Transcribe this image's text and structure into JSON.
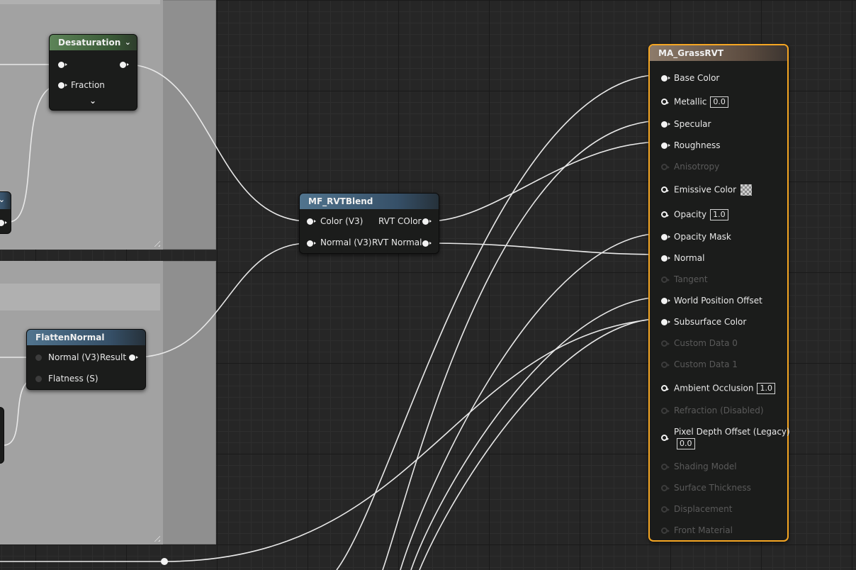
{
  "nodes": {
    "desaturation": {
      "title": "Desaturation",
      "chevron_glyph": "⌄",
      "inputs": [
        {
          "label": ""
        },
        {
          "label": "Fraction"
        }
      ],
      "expand_glyph": "⌄"
    },
    "flatten_normal": {
      "title": "FlattenNormal",
      "inputs": [
        {
          "label": "Normal (V3)"
        },
        {
          "label": "Flatness (S)"
        }
      ],
      "outputs": [
        {
          "label": "Result"
        }
      ]
    },
    "mf_rvtblend": {
      "title": "MF_RVTBlend",
      "inputs": [
        {
          "label": "Color (V3)"
        },
        {
          "label": "Normal (V3)"
        }
      ],
      "outputs": [
        {
          "label": "RVT COlor"
        },
        {
          "label": "RVT Normal"
        }
      ]
    },
    "partial_top": {
      "chevron_glyph": "⌄"
    }
  },
  "material": {
    "title": "MA_GrassRVT",
    "pins": [
      {
        "label": "Base Color",
        "state": "connected"
      },
      {
        "label": "Metallic",
        "state": "open",
        "value": "0.0"
      },
      {
        "label": "Specular",
        "state": "connected"
      },
      {
        "label": "Roughness",
        "state": "connected"
      },
      {
        "label": "Anisotropy",
        "state": "disabled"
      },
      {
        "label": "Emissive Color",
        "state": "open",
        "swatch": true
      },
      {
        "label": "Opacity",
        "state": "open",
        "value": "1.0"
      },
      {
        "label": "Opacity Mask",
        "state": "connected"
      },
      {
        "label": "Normal",
        "state": "connected"
      },
      {
        "label": "Tangent",
        "state": "disabled"
      },
      {
        "label": "World Position Offset",
        "state": "connected"
      },
      {
        "label": "Subsurface Color",
        "state": "connected"
      },
      {
        "label": "Custom Data 0",
        "state": "disabled"
      },
      {
        "label": "Custom Data 1",
        "state": "disabled"
      },
      {
        "label": "Ambient Occlusion",
        "state": "open",
        "value": "1.0"
      },
      {
        "label": "Refraction (Disabled)",
        "state": "disabled"
      },
      {
        "label": "Pixel Depth Offset (Legacy)",
        "state": "open",
        "value": "0.0"
      },
      {
        "label": "Shading Model",
        "state": "disabled"
      },
      {
        "label": "Surface Thickness",
        "state": "disabled"
      },
      {
        "label": "Displacement",
        "state": "disabled"
      },
      {
        "label": "Front Material",
        "state": "disabled"
      }
    ]
  },
  "colors": {
    "grid_bg": "#262626",
    "comment_box": "#8f8f8f",
    "wire": "#e8e8e8",
    "selected_border": "#f5a623"
  }
}
